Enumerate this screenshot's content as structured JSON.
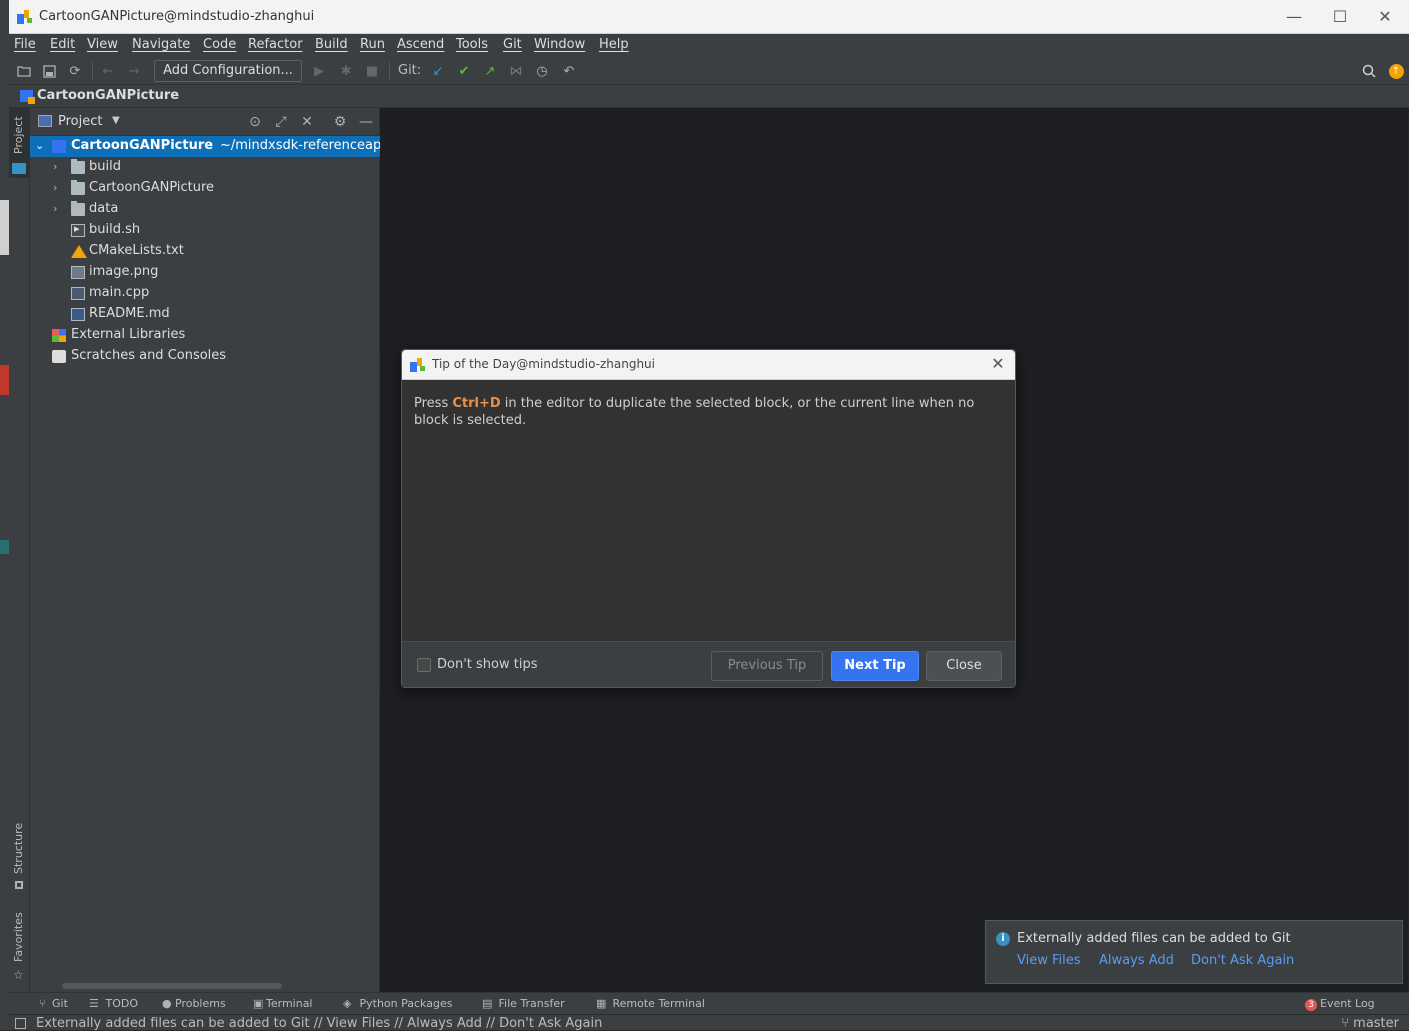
{
  "window": {
    "title": "CartoonGANPicture@mindstudio-zhanghui"
  },
  "menu": [
    "File",
    "Edit",
    "View",
    "Navigate",
    "Code",
    "Refactor",
    "Build",
    "Run",
    "Ascend",
    "Tools",
    "Git",
    "Window",
    "Help"
  ],
  "toolbar": {
    "add_configuration": "Add Configuration...",
    "git_label": "Git:"
  },
  "breadcrumb": {
    "project": "CartoonGANPicture"
  },
  "left_strip": {
    "project": "Project",
    "structure": "Structure",
    "favorites": "Favorites"
  },
  "project_panel": {
    "title": "Project",
    "root": {
      "name": "CartoonGANPicture",
      "path": "~/mindxsdk-referenceapps"
    },
    "items": [
      {
        "name": "build",
        "kind": "folder"
      },
      {
        "name": "CartoonGANPicture",
        "kind": "folder"
      },
      {
        "name": "data",
        "kind": "folder"
      },
      {
        "name": "build.sh",
        "kind": "shell"
      },
      {
        "name": "CMakeLists.txt",
        "kind": "cmake"
      },
      {
        "name": "image.png",
        "kind": "image"
      },
      {
        "name": "main.cpp",
        "kind": "cpp"
      },
      {
        "name": "README.md",
        "kind": "markdown"
      }
    ],
    "external_libraries": "External Libraries",
    "scratches": "Scratches and Consoles"
  },
  "dialog": {
    "title": "Tip of the Day@mindstudio-zhanghui",
    "tip_prefix": "Press ",
    "tip_key": "Ctrl+D",
    "tip_suffix": " in the editor to duplicate the selected block, or the current line when no block is selected.",
    "dont_show": "Don't show tips",
    "previous": "Previous Tip",
    "next": "Next Tip",
    "close": "Close"
  },
  "notification": {
    "message": "Externally added files can be added to Git",
    "view_files": "View Files",
    "always_add": "Always Add",
    "dont_ask": "Don't Ask Again"
  },
  "bottom_tools": {
    "git": "Git",
    "todo": "TODO",
    "problems": "Problems",
    "terminal": "Terminal",
    "python_packages": "Python Packages",
    "file_transfer": "File Transfer",
    "remote_terminal": "Remote Terminal",
    "event_log_count": "3",
    "event_log": "Event Log"
  },
  "status": {
    "message": "Externally added files can be added to Git // View Files // Always Add // Don't Ask Again",
    "branch": "master"
  },
  "colors": {
    "accent": "#3574f0",
    "selection": "#0d6fb8",
    "link": "#589df6",
    "shortcut": "#e8914d"
  }
}
